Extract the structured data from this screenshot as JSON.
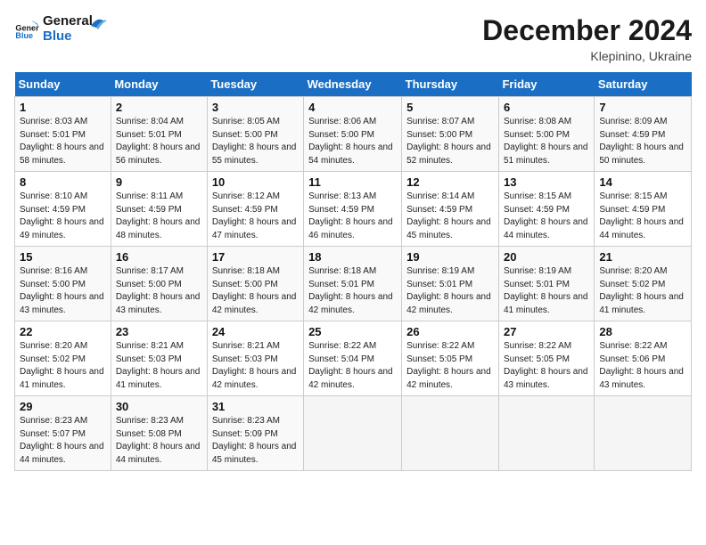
{
  "logo": {
    "line1": "General",
    "line2": "Blue"
  },
  "title": "December 2024",
  "location": "Klepinino, Ukraine",
  "days_of_week": [
    "Sunday",
    "Monday",
    "Tuesday",
    "Wednesday",
    "Thursday",
    "Friday",
    "Saturday"
  ],
  "weeks": [
    [
      {
        "num": "1",
        "sunrise": "8:03 AM",
        "sunset": "5:01 PM",
        "daylight": "8 hours and 58 minutes."
      },
      {
        "num": "2",
        "sunrise": "8:04 AM",
        "sunset": "5:01 PM",
        "daylight": "8 hours and 56 minutes."
      },
      {
        "num": "3",
        "sunrise": "8:05 AM",
        "sunset": "5:00 PM",
        "daylight": "8 hours and 55 minutes."
      },
      {
        "num": "4",
        "sunrise": "8:06 AM",
        "sunset": "5:00 PM",
        "daylight": "8 hours and 54 minutes."
      },
      {
        "num": "5",
        "sunrise": "8:07 AM",
        "sunset": "5:00 PM",
        "daylight": "8 hours and 52 minutes."
      },
      {
        "num": "6",
        "sunrise": "8:08 AM",
        "sunset": "5:00 PM",
        "daylight": "8 hours and 51 minutes."
      },
      {
        "num": "7",
        "sunrise": "8:09 AM",
        "sunset": "4:59 PM",
        "daylight": "8 hours and 50 minutes."
      }
    ],
    [
      {
        "num": "8",
        "sunrise": "8:10 AM",
        "sunset": "4:59 PM",
        "daylight": "8 hours and 49 minutes."
      },
      {
        "num": "9",
        "sunrise": "8:11 AM",
        "sunset": "4:59 PM",
        "daylight": "8 hours and 48 minutes."
      },
      {
        "num": "10",
        "sunrise": "8:12 AM",
        "sunset": "4:59 PM",
        "daylight": "8 hours and 47 minutes."
      },
      {
        "num": "11",
        "sunrise": "8:13 AM",
        "sunset": "4:59 PM",
        "daylight": "8 hours and 46 minutes."
      },
      {
        "num": "12",
        "sunrise": "8:14 AM",
        "sunset": "4:59 PM",
        "daylight": "8 hours and 45 minutes."
      },
      {
        "num": "13",
        "sunrise": "8:15 AM",
        "sunset": "4:59 PM",
        "daylight": "8 hours and 44 minutes."
      },
      {
        "num": "14",
        "sunrise": "8:15 AM",
        "sunset": "4:59 PM",
        "daylight": "8 hours and 44 minutes."
      }
    ],
    [
      {
        "num": "15",
        "sunrise": "8:16 AM",
        "sunset": "5:00 PM",
        "daylight": "8 hours and 43 minutes."
      },
      {
        "num": "16",
        "sunrise": "8:17 AM",
        "sunset": "5:00 PM",
        "daylight": "8 hours and 43 minutes."
      },
      {
        "num": "17",
        "sunrise": "8:18 AM",
        "sunset": "5:00 PM",
        "daylight": "8 hours and 42 minutes."
      },
      {
        "num": "18",
        "sunrise": "8:18 AM",
        "sunset": "5:01 PM",
        "daylight": "8 hours and 42 minutes."
      },
      {
        "num": "19",
        "sunrise": "8:19 AM",
        "sunset": "5:01 PM",
        "daylight": "8 hours and 42 minutes."
      },
      {
        "num": "20",
        "sunrise": "8:19 AM",
        "sunset": "5:01 PM",
        "daylight": "8 hours and 41 minutes."
      },
      {
        "num": "21",
        "sunrise": "8:20 AM",
        "sunset": "5:02 PM",
        "daylight": "8 hours and 41 minutes."
      }
    ],
    [
      {
        "num": "22",
        "sunrise": "8:20 AM",
        "sunset": "5:02 PM",
        "daylight": "8 hours and 41 minutes."
      },
      {
        "num": "23",
        "sunrise": "8:21 AM",
        "sunset": "5:03 PM",
        "daylight": "8 hours and 41 minutes."
      },
      {
        "num": "24",
        "sunrise": "8:21 AM",
        "sunset": "5:03 PM",
        "daylight": "8 hours and 42 minutes."
      },
      {
        "num": "25",
        "sunrise": "8:22 AM",
        "sunset": "5:04 PM",
        "daylight": "8 hours and 42 minutes."
      },
      {
        "num": "26",
        "sunrise": "8:22 AM",
        "sunset": "5:05 PM",
        "daylight": "8 hours and 42 minutes."
      },
      {
        "num": "27",
        "sunrise": "8:22 AM",
        "sunset": "5:05 PM",
        "daylight": "8 hours and 43 minutes."
      },
      {
        "num": "28",
        "sunrise": "8:22 AM",
        "sunset": "5:06 PM",
        "daylight": "8 hours and 43 minutes."
      }
    ],
    [
      {
        "num": "29",
        "sunrise": "8:23 AM",
        "sunset": "5:07 PM",
        "daylight": "8 hours and 44 minutes."
      },
      {
        "num": "30",
        "sunrise": "8:23 AM",
        "sunset": "5:08 PM",
        "daylight": "8 hours and 44 minutes."
      },
      {
        "num": "31",
        "sunrise": "8:23 AM",
        "sunset": "5:09 PM",
        "daylight": "8 hours and 45 minutes."
      },
      null,
      null,
      null,
      null
    ]
  ]
}
